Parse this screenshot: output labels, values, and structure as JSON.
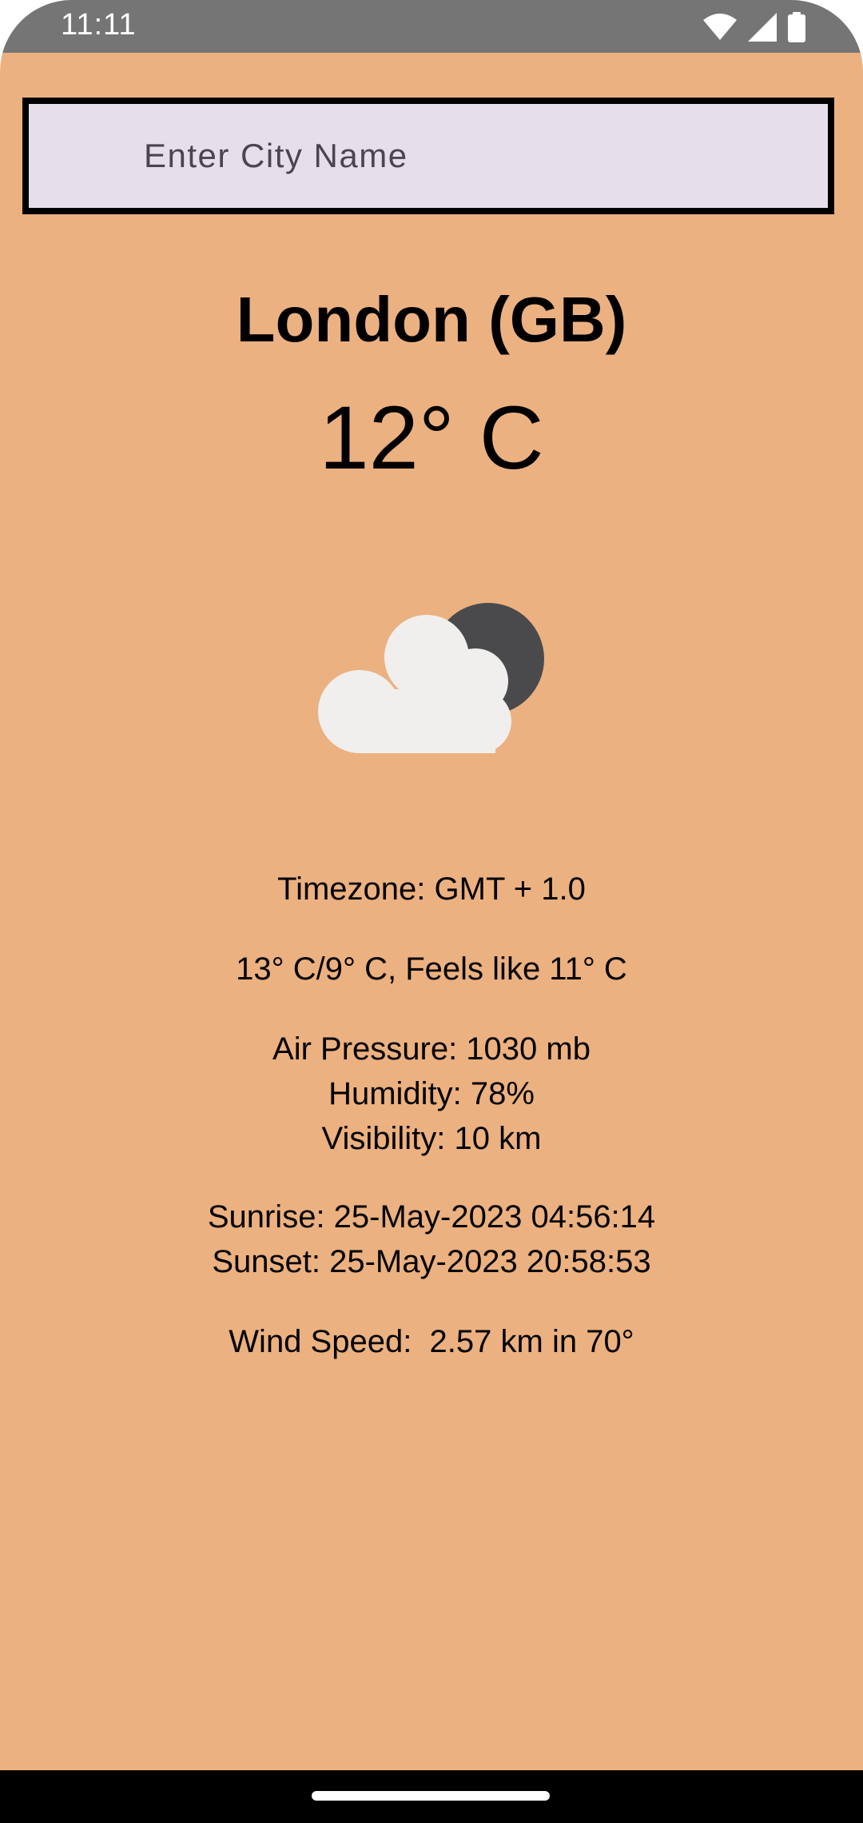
{
  "theme": {
    "app_background": "#ECB180",
    "status_bar_background": "#757575",
    "input_background": "#E6DFEB",
    "cloud_color": "#F0EFED",
    "moon_color": "#4A4A4C"
  },
  "status_bar": {
    "time": "11:11",
    "icons": [
      "wifi-icon",
      "cell-signal-icon",
      "battery-icon"
    ]
  },
  "search": {
    "placeholder": "Enter City Name",
    "value": ""
  },
  "weather": {
    "city": "London (GB)",
    "temperature": "12° C",
    "icon": "partly-cloudy-night-icon",
    "timezone": "Timezone: GMT + 1.0",
    "temp_range": "13° C/9° C, Feels like 11° C",
    "air_pressure": "Air Pressure: 1030 mb",
    "humidity": "Humidity: 78%",
    "visibility": "Visibility: 10 km",
    "sunrise": "Sunrise: 25-May-2023 04:56:14",
    "sunset": "Sunset: 25-May-2023 20:58:53",
    "wind": "Wind Speed:  2.57 km in 70°"
  }
}
